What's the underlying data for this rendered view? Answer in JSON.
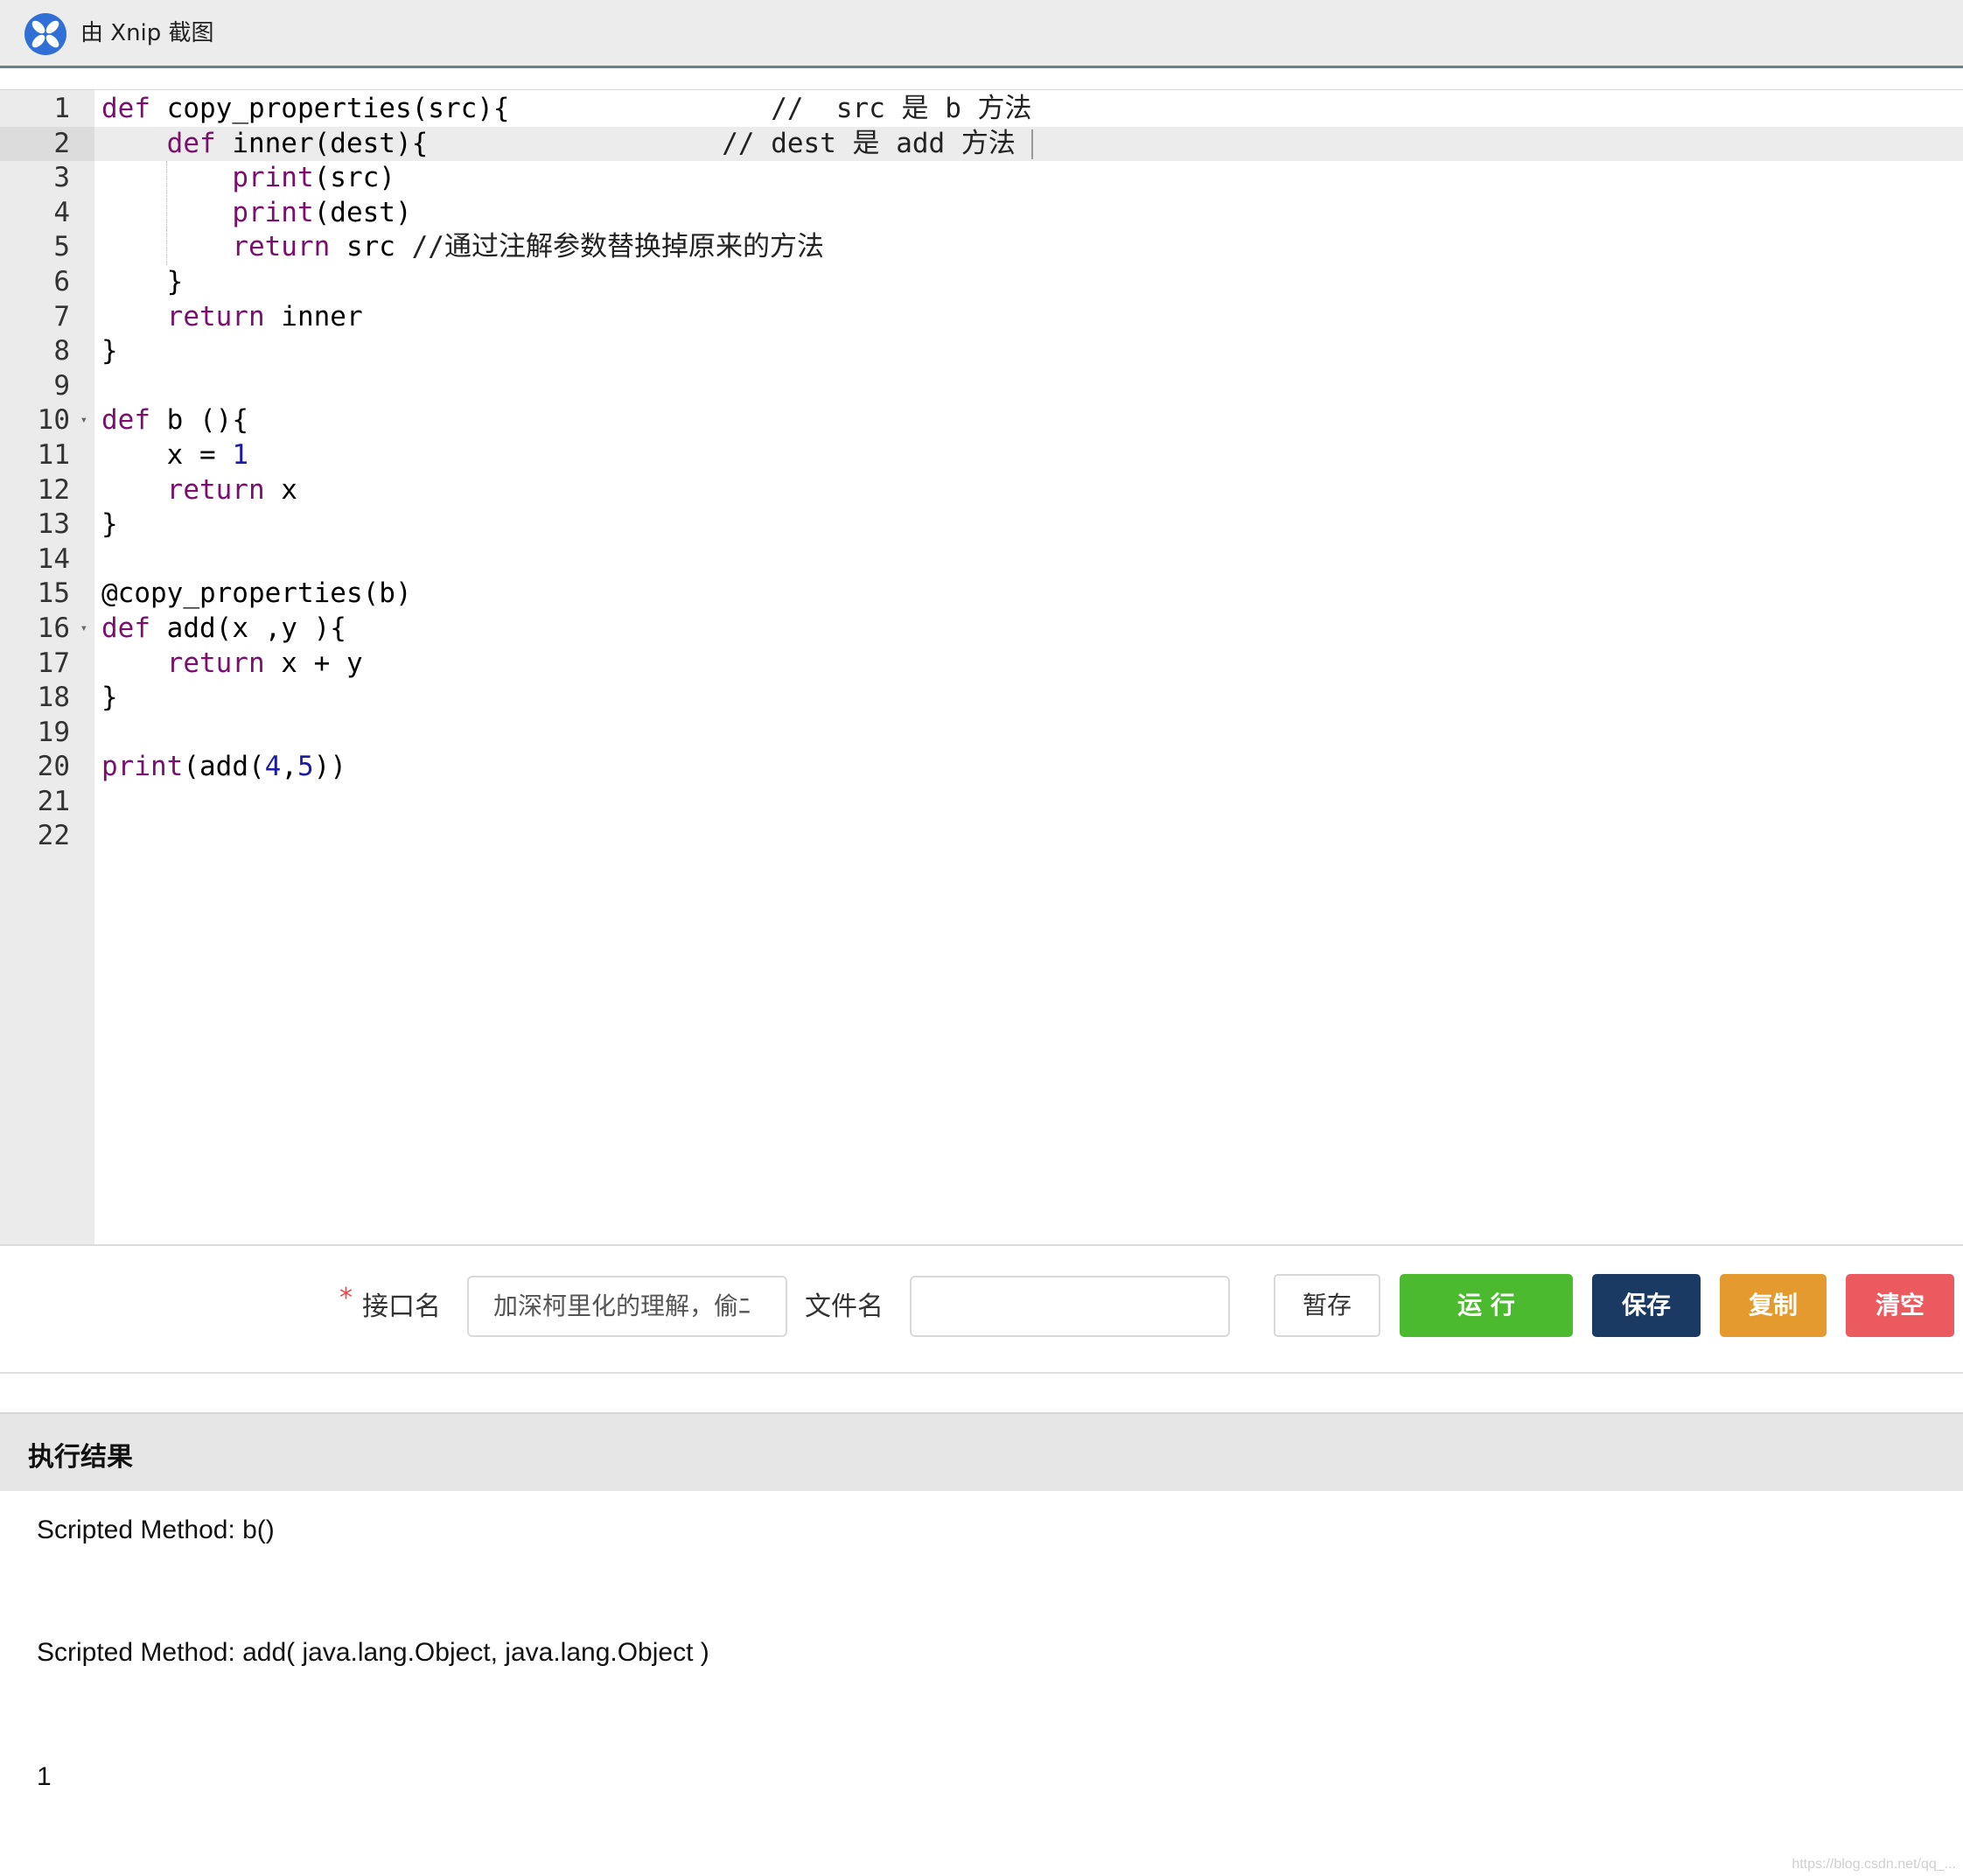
{
  "topbar": {
    "title": "由 Xnip 截图",
    "brand_color": "#2f6fd6"
  },
  "editor": {
    "active_line": 2,
    "folded_lines": [
      10,
      16
    ],
    "fold_glyph": "▾",
    "line_numbers": [
      "1",
      "2",
      "3",
      "4",
      "5",
      "6",
      "7",
      "8",
      "9",
      "10",
      "11",
      "12",
      "13",
      "14",
      "15",
      "16",
      "17",
      "18",
      "19",
      "20",
      "21",
      "22"
    ],
    "lines": [
      [
        {
          "t": "def",
          "c": "kw"
        },
        {
          "t": " copy_properties(src){                "
        },
        {
          "t": "//  src 是 b 方法",
          "c": "cmt"
        }
      ],
      [
        {
          "t": "    "
        },
        {
          "t": "def",
          "c": "kw"
        },
        {
          "t": " inner(dest){                  "
        },
        {
          "t": "// dest 是 add 方法",
          "c": "cmt"
        }
      ],
      [
        {
          "t": "        "
        },
        {
          "t": "print",
          "c": "kw"
        },
        {
          "t": "(src)"
        }
      ],
      [
        {
          "t": "        "
        },
        {
          "t": "print",
          "c": "kw"
        },
        {
          "t": "(dest)"
        }
      ],
      [
        {
          "t": "        "
        },
        {
          "t": "return",
          "c": "kw"
        },
        {
          "t": " src "
        },
        {
          "t": "//通过注解参数替换掉原来的方法",
          "c": "cmt"
        }
      ],
      [
        {
          "t": "    }"
        }
      ],
      [
        {
          "t": "    "
        },
        {
          "t": "return",
          "c": "kw"
        },
        {
          "t": " inner"
        }
      ],
      [
        {
          "t": "}"
        }
      ],
      [
        {
          "t": ""
        }
      ],
      [
        {
          "t": "def",
          "c": "kw"
        },
        {
          "t": " b (){"
        }
      ],
      [
        {
          "t": "    x = "
        },
        {
          "t": "1",
          "c": "num"
        }
      ],
      [
        {
          "t": "    "
        },
        {
          "t": "return",
          "c": "kw"
        },
        {
          "t": " x"
        }
      ],
      [
        {
          "t": "}"
        }
      ],
      [
        {
          "t": ""
        }
      ],
      [
        {
          "t": "@copy_properties(b)"
        }
      ],
      [
        {
          "t": "def",
          "c": "kw"
        },
        {
          "t": " add(x ,y ){"
        }
      ],
      [
        {
          "t": "    "
        },
        {
          "t": "return",
          "c": "kw"
        },
        {
          "t": " x + y"
        }
      ],
      [
        {
          "t": "}"
        }
      ],
      [
        {
          "t": ""
        }
      ],
      [
        {
          "t": "print",
          "c": "kw"
        },
        {
          "t": "(add("
        },
        {
          "t": "4",
          "c": "num"
        },
        {
          "t": ","
        },
        {
          "t": "5",
          "c": "num"
        },
        {
          "t": "))"
        }
      ],
      [
        {
          "t": ""
        }
      ],
      [
        {
          "t": ""
        }
      ]
    ]
  },
  "form": {
    "required_mark": "*",
    "api_name_label": "接口名",
    "api_name_value": "加深柯里化的理解，偷ﾆ",
    "file_name_label": "文件名",
    "file_name_value": ""
  },
  "buttons": {
    "draft": "暂存",
    "run": "运 行",
    "save": "保存",
    "copy": "复制",
    "clear": "清空"
  },
  "results": {
    "title": "执行结果",
    "lines": [
      "Scripted Method: b()",
      "Scripted Method: add( java.lang.Object, java.lang.Object )",
      "1"
    ]
  },
  "watermark": "https://blog.csdn.net/qq_..."
}
